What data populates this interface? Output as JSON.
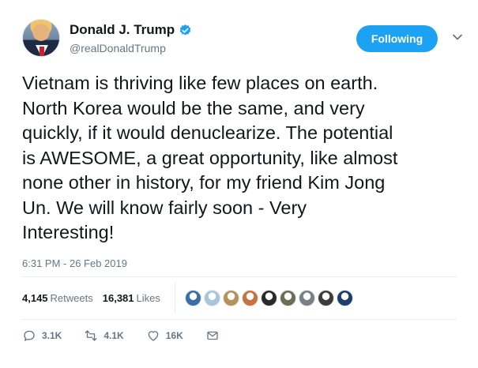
{
  "user": {
    "display_name": "Donald J. Trump",
    "handle": "@realDonaldTrump"
  },
  "follow_button_label": "Following",
  "tweet": {
    "text": "Vietnam is thriving like few places on earth.\nNorth Korea would be the same, and very\nquickly, if it would denuclearize. The potential\nis AWESOME, a great opportunity, like almost\nnone other in history, for my friend Kim Jong\nUn. We will know fairly soon - Very\nInteresting!",
    "timestamp": "6:31 PM - 26 Feb 2019"
  },
  "stats": {
    "retweets_count": "4,145",
    "retweets_label": "Retweets",
    "likes_count": "16,381",
    "likes_label": "Likes"
  },
  "liker_avatar_colors": [
    "#3b6ea5",
    "#a8c6d9",
    "#b5925a",
    "#c8733f",
    "#2a2a2a",
    "#6d6d55",
    "#7a7f86",
    "#3c3c3c",
    "#1f3f6b"
  ],
  "actions": {
    "reply_count": "3.1K",
    "retweet_count": "4.1K",
    "like_count": "16K"
  },
  "colors": {
    "accent": "#1da1f2",
    "text_primary": "#14171a",
    "text_secondary": "#657786"
  }
}
